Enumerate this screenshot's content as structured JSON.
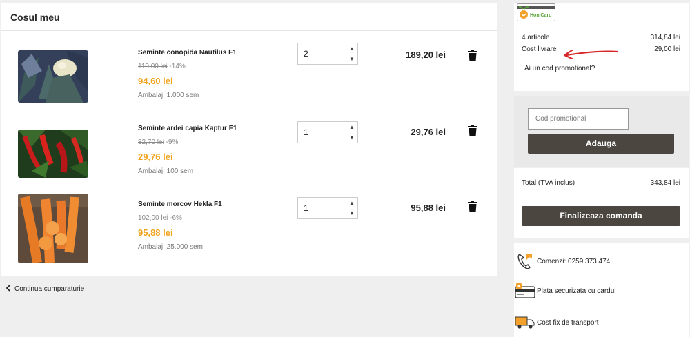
{
  "cart": {
    "title": "Cosul meu",
    "items": [
      {
        "name": "Seminte conopida Nautilus F1",
        "old_price": "110,00 lei",
        "discount": "-14%",
        "price": "94,60 lei",
        "package": "Ambalaj: 1.000 sem",
        "quantity": "2",
        "total": "189,20 lei",
        "image_icon": "cauliflower-photo"
      },
      {
        "name": "Seminte ardei capia Kaptur F1",
        "old_price": "32,70 lei",
        "discount": "-9%",
        "price": "29,76 lei",
        "package": "Ambalaj: 100 sem",
        "quantity": "1",
        "total": "29,76 lei",
        "image_icon": "red-pepper-photo"
      },
      {
        "name": "Seminte morcov Hekla F1",
        "old_price": "102,00 lei",
        "discount": "-6%",
        "price": "95,88 lei",
        "package": "Ambalaj: 25.000 sem",
        "quantity": "1",
        "total": "95,88 lei",
        "image_icon": "carrot-photo"
      }
    ],
    "continue_label": "Continua cumparaturie"
  },
  "summary": {
    "logo_text": "HoniCard",
    "articles_label": "4 articole",
    "articles_value": "314,84 lei",
    "shipping_label": "Cost livrare",
    "shipping_value": "29,00 lei",
    "promo_link": "Ai un cod promotional?"
  },
  "promo": {
    "placeholder": "Cod promotional",
    "add_label": "Adauga"
  },
  "totals": {
    "total_label": "Total (TVA inclus)",
    "total_value": "343,84 lei",
    "checkout_label": "Finalizeaza comanda"
  },
  "info": {
    "phone": "Comenzi: 0259 373 474",
    "secure": "Plata securizata cu cardul",
    "shipping": "Cost fix de transport"
  },
  "colors": {
    "price_orange": "#f0a21a",
    "button_dark": "#4b4640",
    "annotation_red": "#d8262a"
  }
}
